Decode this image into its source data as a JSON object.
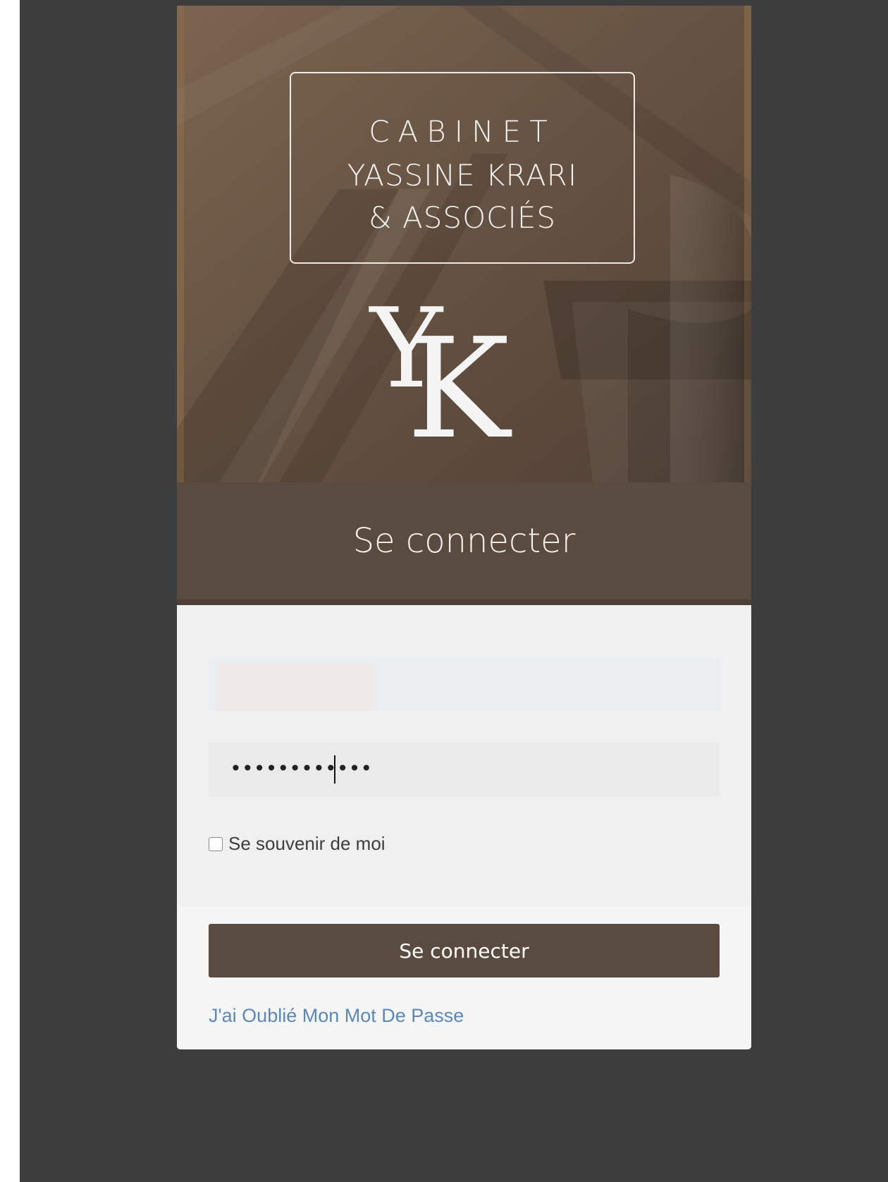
{
  "brand": {
    "line1": "CABINET",
    "line2": "YASSINE KRARI",
    "line3": "& ASSOCIÉS",
    "monogram_left": "Y",
    "monogram_right": "K"
  },
  "title": "Se connecter",
  "form": {
    "password_value": "••••••••••••",
    "remember_label": "Se souvenir de moi",
    "submit_label": "Se connecter",
    "forgot_label": "J'ai Oublié Mon Mot De Passe"
  }
}
